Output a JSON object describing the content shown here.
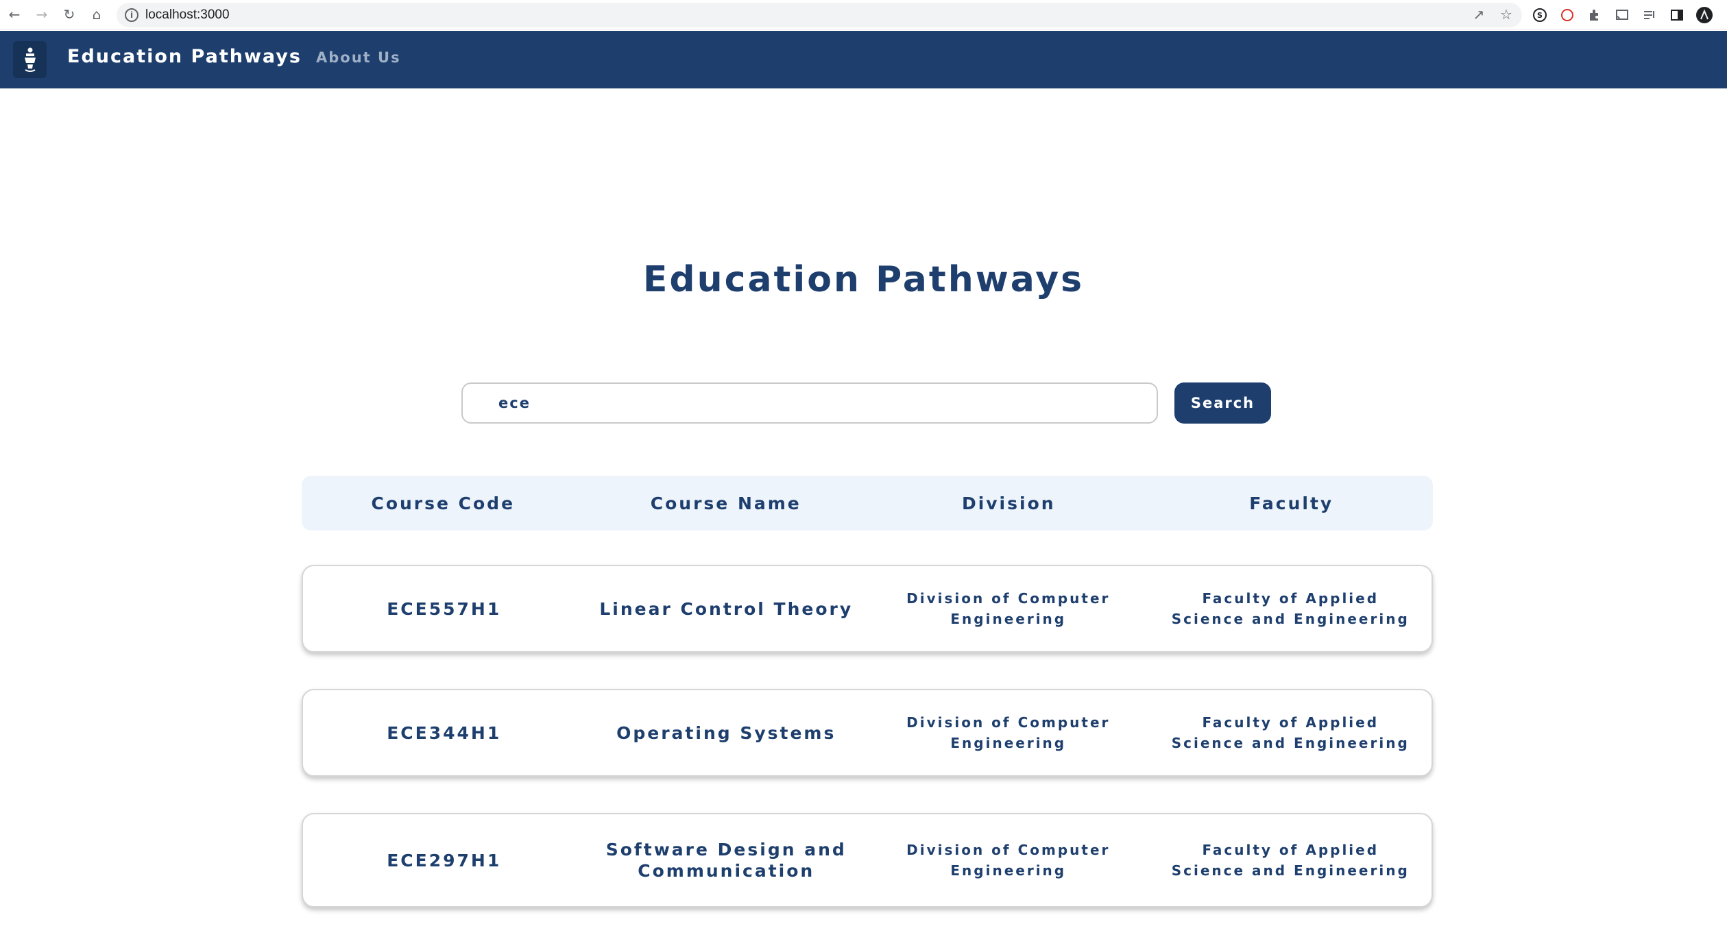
{
  "browser": {
    "url": "localhost:3000"
  },
  "header": {
    "brand": "Education Pathways",
    "nav_about": "About Us"
  },
  "main": {
    "title": "Education Pathways",
    "search": {
      "value": "ece",
      "button_label": "Search"
    },
    "table": {
      "columns": [
        "Course Code",
        "Course Name",
        "Division",
        "Faculty"
      ],
      "rows": [
        {
          "code": "ECE557H1",
          "name": "Linear Control Theory",
          "division": "Division of Computer Engineering",
          "faculty": "Faculty of Applied Science and Engineering"
        },
        {
          "code": "ECE344H1",
          "name": "Operating Systems",
          "division": "Division of Computer Engineering",
          "faculty": "Faculty of Applied Science and Engineering"
        },
        {
          "code": "ECE297H1",
          "name": "Software Design and Communication",
          "division": "Division of Computer Engineering",
          "faculty": "Faculty of Applied Science and Engineering"
        }
      ]
    }
  },
  "colors": {
    "primary": "#1e3f6e",
    "header_row_bg": "#eef4fc",
    "nav_muted": "#9fb0c7"
  }
}
